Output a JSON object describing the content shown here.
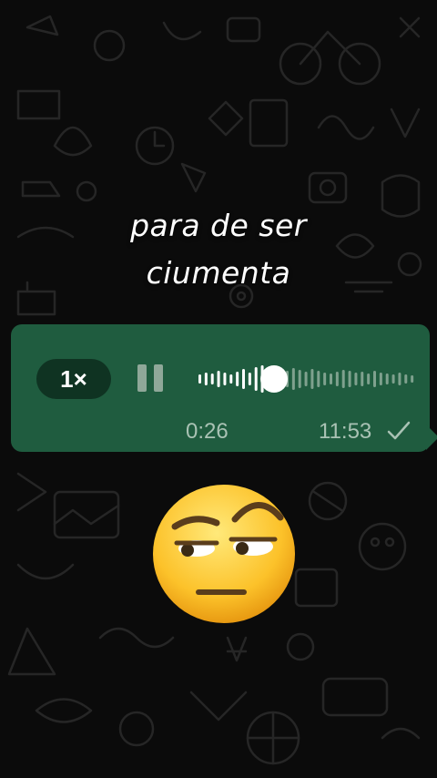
{
  "caption": {
    "line1": "para de ser",
    "line2": "ciumenta"
  },
  "voice_message": {
    "speed": "1×",
    "elapsed": "0:26",
    "sent_time": "11:53",
    "progress": 0.35,
    "status_icon": "single-check-icon",
    "play_state_icon": "pause-icon"
  },
  "colors": {
    "bubble": "#1f5c3f",
    "background": "#0b0b0b",
    "meta_text": "#a9c2b4"
  },
  "emoji": "unamused-raised-eyebrow-face"
}
